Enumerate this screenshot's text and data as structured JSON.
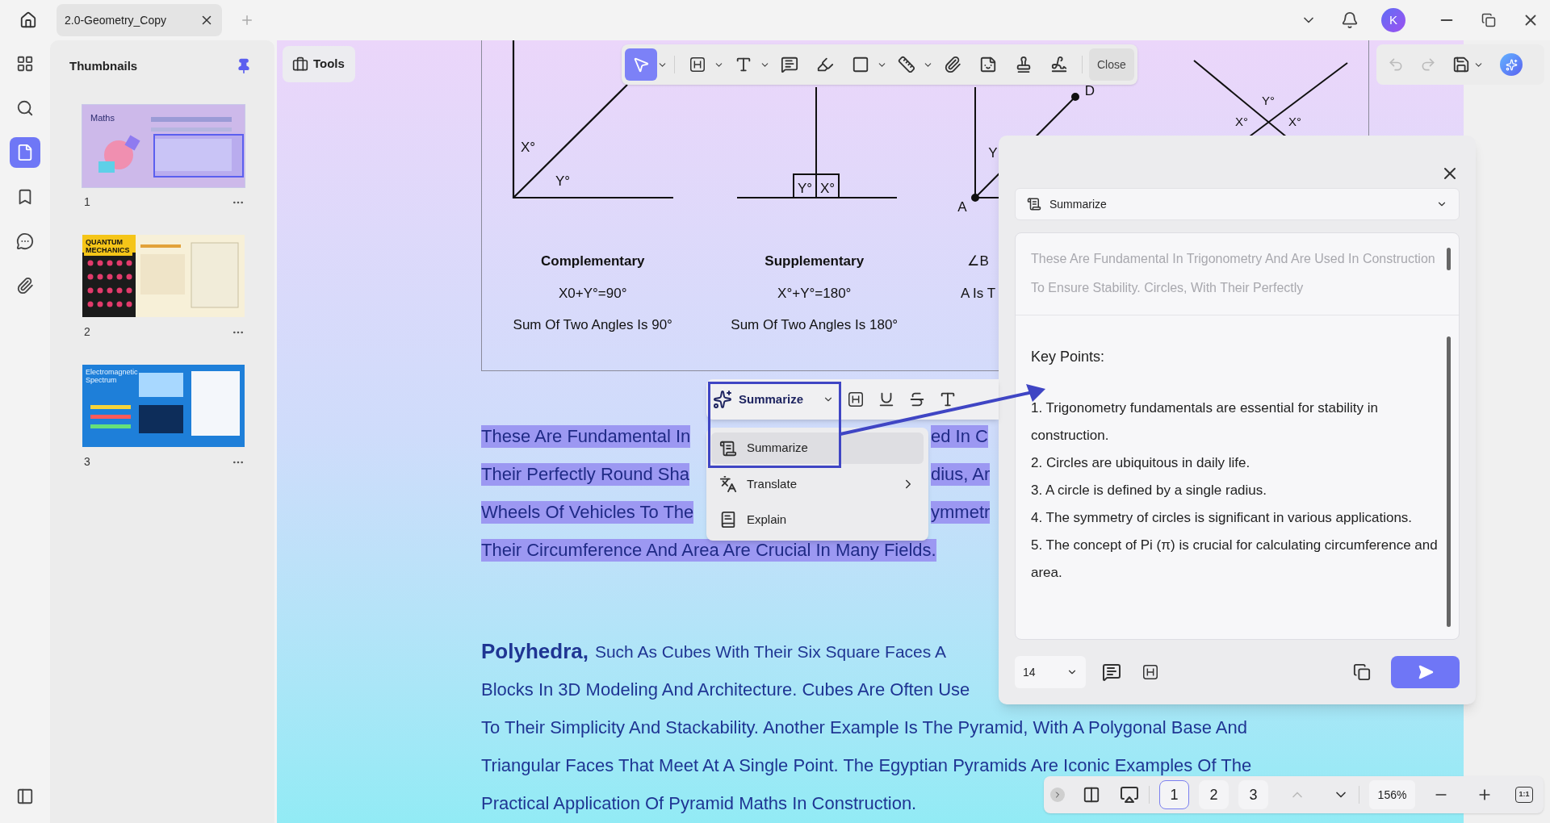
{
  "tabs": [
    {
      "label": "2.0-Geometry_Copy",
      "selected": true
    }
  ],
  "account": {
    "initial": "K"
  },
  "rail": [
    {
      "kind": "apps",
      "selected": false
    },
    {
      "kind": "search",
      "selected": false
    },
    {
      "kind": "pages",
      "selected": true
    },
    {
      "kind": "bookmarks",
      "selected": false
    },
    {
      "kind": "comments",
      "selected": false
    },
    {
      "kind": "attachments",
      "selected": false
    }
  ],
  "thumbnails": {
    "title": "Thumbnails",
    "pages": [
      {
        "kind": "maths",
        "heading": "Maths",
        "number": "1",
        "selected": true
      },
      {
        "kind": "quantum",
        "heading": "QUANTUM MECHANICS",
        "number": "2",
        "selected": false
      },
      {
        "kind": "spectrum",
        "heading": "Electromagnetic Spectrum",
        "number": "3",
        "selected": false
      }
    ]
  },
  "tools_button": "Tools",
  "toolbar": {
    "tools": [
      {
        "kind": "select",
        "selected": true,
        "menu": true
      },
      {
        "kind": "heading",
        "selected": false,
        "menu": true
      },
      {
        "kind": "text",
        "selected": false,
        "menu": true
      },
      {
        "kind": "comment",
        "selected": false,
        "menu": false
      },
      {
        "kind": "highlighter",
        "selected": false,
        "menu": false
      },
      {
        "kind": "shape",
        "selected": false,
        "menu": true
      },
      {
        "kind": "measure",
        "selected": false,
        "menu": true
      },
      {
        "kind": "attach",
        "selected": false,
        "menu": false
      },
      {
        "kind": "sticker",
        "selected": false,
        "menu": false
      },
      {
        "kind": "stamp",
        "selected": false,
        "menu": false
      },
      {
        "kind": "signature",
        "selected": false,
        "menu": false
      }
    ],
    "close": "Close"
  },
  "figures": [
    {
      "kind": "angle",
      "labels": [
        "X°",
        "Y°"
      ],
      "title": "Complementary",
      "formula": "X0+Y°=90°",
      "caption": "Sum Of Two Angles Is 90°"
    },
    {
      "kind": "parallel",
      "labels": [
        "Y°",
        "X°"
      ],
      "title": "Supplementary",
      "formula": "X°+Y°=180°",
      "caption": "Sum Of Two Angles Is 180°"
    },
    {
      "kind": "triangle",
      "labels": [
        "D",
        "Y",
        "A"
      ],
      "formula": "∠B",
      "caption": "A Is T"
    },
    {
      "kind": "cross",
      "labels": [
        "Y°",
        "X°",
        "X°"
      ]
    }
  ],
  "selected_text": [
    {
      "left": "These Are Fundamental In",
      "right": "ed In C"
    },
    {
      "left": "Their Perfectly Round Sha",
      "right": "dius, Ar"
    },
    {
      "left": "Wheels Of Vehicles To The",
      "right": "ymmetr"
    },
    {
      "left": "Their Circumference And Area Are Crucial In Many Fields."
    }
  ],
  "selection_toolbar": {
    "action": "Summarize",
    "menu": [
      {
        "kind": "summarize",
        "label": "Summarize",
        "selected": true,
        "submenu": false
      },
      {
        "kind": "translate",
        "label": "Translate",
        "selected": false,
        "submenu": true
      },
      {
        "kind": "explain",
        "label": "Explain",
        "selected": false,
        "submenu": false
      }
    ]
  },
  "paragraph": {
    "lead": "Polyhedra,",
    "lines": [
      "Such As Cubes With Their Six Square Faces A",
      "Blocks In 3D Modeling And Architecture. Cubes Are Often Use",
      "To Their Simplicity And Stackability. Another Example Is The Pyramid, With A Polygonal Base And",
      "Triangular Faces That Meet At A Single Point. The Egyptian Pyramids Are Iconic Examples Of The",
      "Practical Application Of Pyramid Maths In Construction."
    ]
  },
  "ai_panel": {
    "mode": "Summarize",
    "source": "These Are Fundamental In Trigonometry And Are Used In Construction To Ensure Stability. Circles, With Their Perfectly",
    "heading": "Key Points:",
    "points": [
      "1. Trigonometry fundamentals are essential for stability in construction.",
      "2. Circles are ubiquitous in daily life.",
      "3. A circle is defined by a single radius.",
      "4. The symmetry of circles is significant in various applications.",
      "5. The concept of Pi (π) is crucial for calculating circumference and area."
    ],
    "font_size": "14"
  },
  "page_nav": {
    "pages": [
      {
        "label": "1",
        "selected": true
      },
      {
        "label": "2",
        "selected": false
      },
      {
        "label": "3",
        "selected": false
      }
    ],
    "zoom": "156%",
    "fit": "1:1"
  }
}
